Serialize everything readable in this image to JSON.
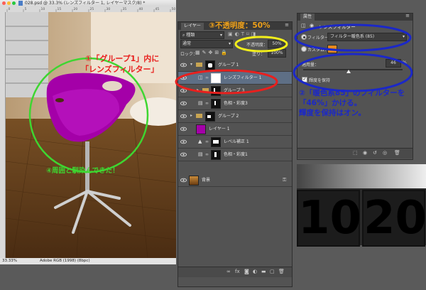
{
  "document": {
    "title": "028.psd @ 33.3% (レンズフィルター 1, レイヤーマスク/8) *",
    "zoom": "33.33%",
    "profile": "Adobe RGB (1998) (8bpc)",
    "ruler_ticks": [
      "0",
      "5",
      "10",
      "15",
      "20",
      "25",
      "30",
      "35",
      "40",
      "45",
      "50"
    ]
  },
  "layers_panel": {
    "tab": "レイヤー",
    "filter_label": "種類",
    "blend_mode": "通常",
    "opacity_label": "不透明度：",
    "opacity_value": "50%",
    "lock_label": "ロック：",
    "fill_label": "塗り：",
    "fill_value": "100%",
    "layers": [
      {
        "name": "グループ 1",
        "type": "group-open",
        "indent": 0
      },
      {
        "name": "レンズフィルター 1",
        "type": "adjust",
        "indent": 1,
        "selected": true
      },
      {
        "name": "グループ 3",
        "type": "group",
        "indent": 1
      },
      {
        "name": "色相・彩度3",
        "type": "adjust",
        "indent": 1
      },
      {
        "name": "グループ 2",
        "type": "group",
        "indent": 0
      },
      {
        "name": "レイヤー 1",
        "type": "fill",
        "indent": 0
      },
      {
        "name": "レベル補正 1",
        "type": "adjust",
        "indent": 0
      },
      {
        "name": "色相・彩度1",
        "type": "adjust",
        "indent": 0
      },
      {
        "name": "背景",
        "type": "background",
        "indent": 0
      }
    ]
  },
  "properties_panel": {
    "tab": "属性",
    "title": "レンズフィルター",
    "filter_label": "フィルター：",
    "filter_value": "フィルター暖色系 (85)",
    "custom_label": "カスタム：",
    "density_label": "適用量：",
    "density_value": "46",
    "density_unit": "%",
    "density_fraction": 0.46,
    "preserve_label": "輝度を保持"
  },
  "annotations": {
    "a1_line1": "①「グループ1」内に",
    "a1_line2": "「レンズフィルター」",
    "a2_line1": "②「暖色系85」のフィルターを",
    "a2_line2": "「46%」かける。",
    "a2_line3": "輝度を保持はオン。",
    "a3": "③不透明度：50%",
    "a4": "④周囲と馴染んできた！"
  },
  "background_digits": [
    "10",
    "20"
  ],
  "colors": {
    "red": "#e8201e",
    "blue": "#1b28c8",
    "yellow": "#f2ee1a",
    "green": "#3ed631",
    "orange_text": "#f0a21a",
    "purple": "#a400a8",
    "filter_swatch": "#e8891c"
  }
}
